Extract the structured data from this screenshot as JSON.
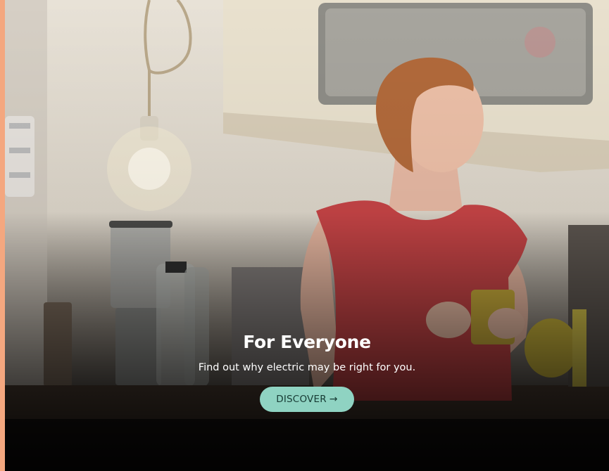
{
  "hero": {
    "headline": "For Everyone",
    "subline": "Find out why electric may be right for you.",
    "cta_label": "DISCOVER",
    "cta_icon": "arrow-right-icon",
    "cta_glyph": "→"
  },
  "colors": {
    "accent_edge": "#f4a77f",
    "cta_background": "#8fd3c2",
    "cta_text": "#163a33",
    "text": "#ffffff"
  }
}
